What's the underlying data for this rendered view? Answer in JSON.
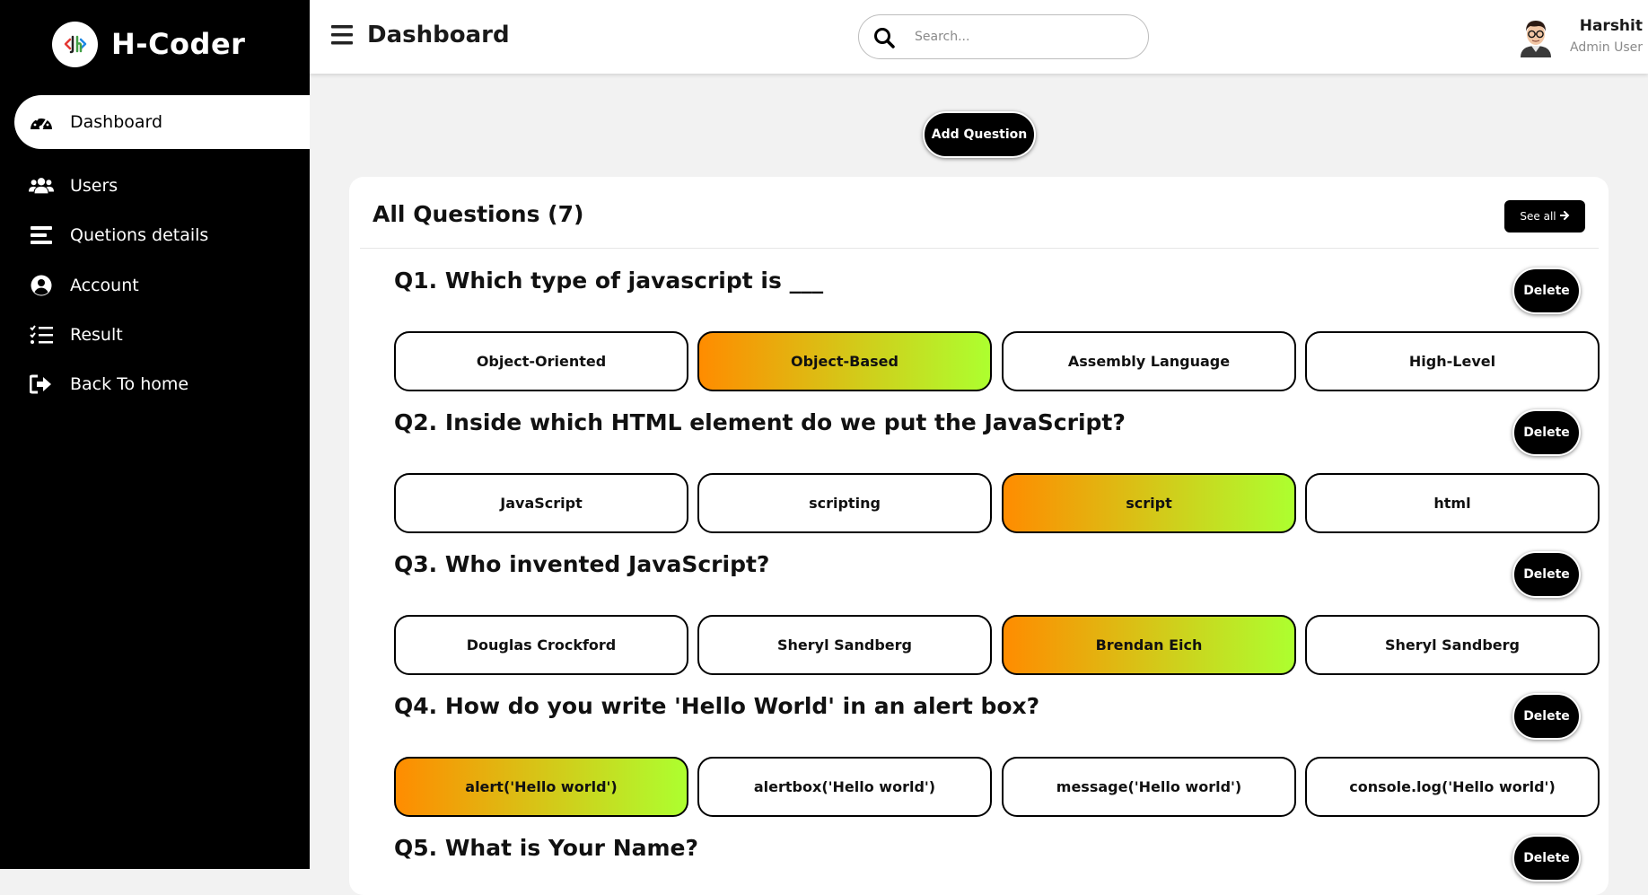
{
  "brand": {
    "name": "H-Coder"
  },
  "sidebar": {
    "items": [
      {
        "label": "Dashboard",
        "icon": "gauge-icon"
      },
      {
        "label": "Users",
        "icon": "users-icon"
      },
      {
        "label": "Quetions details",
        "icon": "list-icon"
      },
      {
        "label": "Account",
        "icon": "user-circle-icon"
      },
      {
        "label": "Result",
        "icon": "checklist-icon"
      },
      {
        "label": "Back To home",
        "icon": "sign-out-icon"
      }
    ],
    "active_index": 0
  },
  "header": {
    "title": "Dashboard",
    "search_placeholder": "Search...",
    "user": {
      "name": "Harshit",
      "role": "Admin User"
    }
  },
  "main": {
    "add_question_label": "Add Question",
    "card_title": "All Questions (7)",
    "see_all_label": "See all",
    "delete_label": "Delete",
    "questions": [
      {
        "title": "Q1. Which type of javascript is ___",
        "options": [
          "Object-Oriented",
          "Object-Based",
          "Assembly Language",
          "High-Level"
        ],
        "correct": 1
      },
      {
        "title": "Q2. Inside which HTML element do we put the JavaScript?",
        "options": [
          "JavaScript",
          "scripting",
          "script",
          "html"
        ],
        "correct": 2
      },
      {
        "title": "Q3. Who invented JavaScript?",
        "options": [
          "Douglas Crockford",
          "Sheryl Sandberg",
          "Brendan Eich",
          "Sheryl Sandberg"
        ],
        "correct": 2
      },
      {
        "title": "Q4. How do you write 'Hello World' in an alert box?",
        "options": [
          "alert('Hello world')",
          "alertbox('Hello world')",
          "message('Hello world')",
          "console.log('Hello world')"
        ],
        "correct": 0
      },
      {
        "title": "Q5. What is Your Name?",
        "options": [],
        "correct": -1
      }
    ]
  },
  "colors": {
    "correct_gradient_start": "#ff8c00",
    "correct_gradient_end": "#adff2f",
    "sidebar_bg": "#000000"
  }
}
